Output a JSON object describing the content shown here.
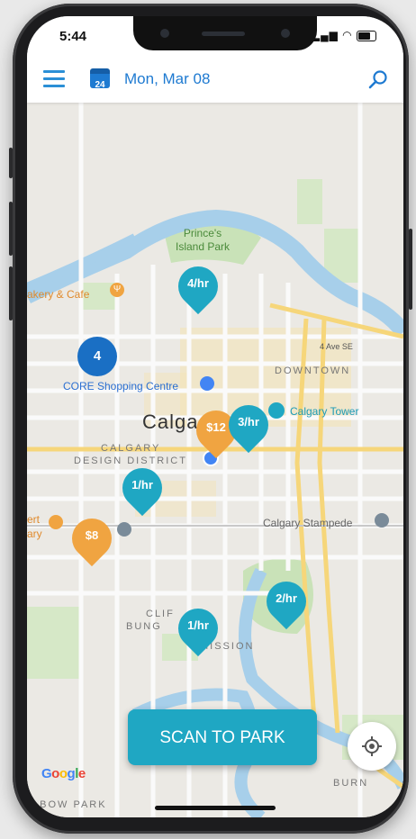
{
  "status_bar": {
    "time": "5:44",
    "signal": "..ll",
    "wifi": "wifi",
    "battery": "battery"
  },
  "app_bar": {
    "date": "Mon, Mar 08",
    "calendar_day": "24"
  },
  "map": {
    "labels": {
      "park": [
        "Prince's",
        "Island Park"
      ],
      "bakery": "akery & Cafe",
      "core": "CORE Shopping Centre",
      "downtown": "DOWNTOWN",
      "calgary": "Calga",
      "calgary_tower": "Calgary Tower",
      "design1": "CALGARY",
      "design2": "DESIGN DISTRICT",
      "stampede": "Calgary Stampede",
      "mission": "MISSION",
      "cliff1": "CLIF",
      "cliff2": "BUNG",
      "elbow": "LBOW PARK",
      "burns": "BURN",
      "ert": "ert",
      "ary": "ary",
      "ave4": "4 Ave SE"
    },
    "pins": [
      {
        "label": "4/hr",
        "color": "teal"
      },
      {
        "label": "4",
        "color": "blue"
      },
      {
        "label": "$12",
        "color": "orange"
      },
      {
        "label": "3/hr",
        "color": "teal"
      },
      {
        "label": "1/hr",
        "color": "teal"
      },
      {
        "label": "$8",
        "color": "orange"
      },
      {
        "label": "2/hr",
        "color": "teal"
      },
      {
        "label": "1/hr",
        "color": "teal"
      }
    ],
    "google_logo": "Google"
  },
  "scan_button": "SCAN TO PARK",
  "colors": {
    "accent": "#1fa7c3",
    "blue": "#1e7ad1",
    "orange": "#f0a441"
  }
}
